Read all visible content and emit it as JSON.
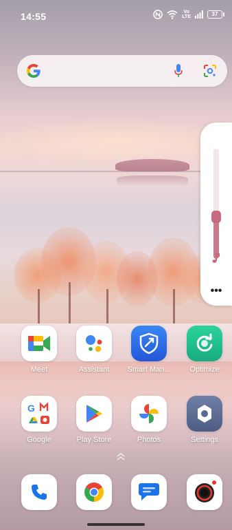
{
  "status_bar": {
    "time": "14:55",
    "volte_top": "Vo",
    "volte_bottom": "LTE",
    "battery": "37"
  },
  "search_bar": {
    "icons": [
      "google-g-icon",
      "microphone-icon",
      "google-lens-icon"
    ]
  },
  "volume_panel": {
    "level_percent": 38,
    "stream_icon": "music-note-icon",
    "more_label": "•••"
  },
  "apps_row1": [
    {
      "label": "Meet",
      "icon": "meet-icon"
    },
    {
      "label": "Assistant",
      "icon": "assistant-icon"
    },
    {
      "label": "Smart Man...",
      "icon": "smart-manager-icon"
    },
    {
      "label": "Optimize",
      "icon": "optimize-icon"
    }
  ],
  "apps_row2": [
    {
      "label": "Google",
      "icon": "google-folder-icon"
    },
    {
      "label": "Play Store",
      "icon": "play-store-icon"
    },
    {
      "label": "Photos",
      "icon": "photos-icon"
    },
    {
      "label": "Settings",
      "icon": "settings-icon"
    }
  ],
  "dock": [
    {
      "icon": "phone-icon"
    },
    {
      "icon": "chrome-icon"
    },
    {
      "icon": "messages-icon"
    },
    {
      "icon": "camera-icon"
    }
  ],
  "colors": {
    "google_blue": "#4285F4",
    "google_red": "#EA4335",
    "google_yellow": "#FBBC05",
    "google_green": "#34A853",
    "volume_fill": "#cd7a8e",
    "smart_manager": "#2f6ee6",
    "optimize": "#1fbf8f"
  }
}
